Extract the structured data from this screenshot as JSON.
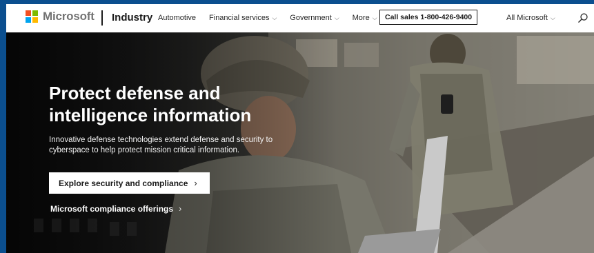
{
  "header": {
    "logo_text": "Microsoft",
    "brand": "Industry",
    "nav": [
      {
        "label": "Automotive",
        "chevron": ""
      },
      {
        "label": "Financial services",
        "chevron": "⌵"
      },
      {
        "label": "Government",
        "chevron": "⌵"
      },
      {
        "label": "More",
        "chevron": "⌵"
      }
    ],
    "call_sales": "Call sales 1-800-426-9400",
    "all_microsoft": "All Microsoft",
    "all_microsoft_chevron": "⌵",
    "logo_colors": [
      "#f25022",
      "#7fba00",
      "#00a4ef",
      "#ffb900"
    ]
  },
  "hero": {
    "title": "Protect defense and intelligence information",
    "description": "Innovative defense technologies extend defense and security to cyberspace to help protect mission critical information.",
    "primary_cta": "Explore security and compliance",
    "primary_cta_arrow": "›",
    "secondary_link": "Microsoft compliance offerings",
    "secondary_link_arrow": "›"
  },
  "icons": [
    "search-icon",
    "chevron-down-icon",
    "chevron-right-icon"
  ]
}
